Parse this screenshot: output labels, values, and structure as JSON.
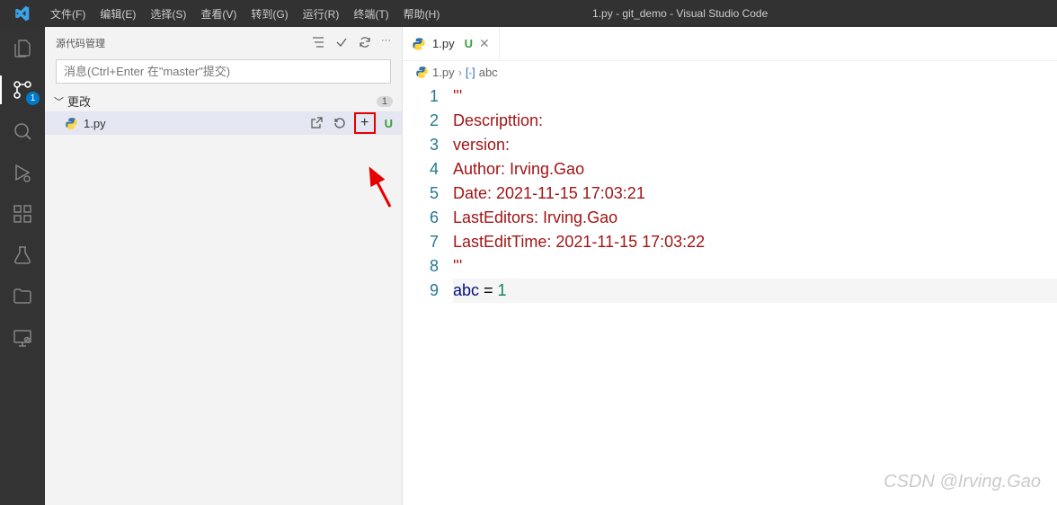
{
  "title": "1.py - git_demo - Visual Studio Code",
  "menu": [
    "文件(F)",
    "编辑(E)",
    "选择(S)",
    "查看(V)",
    "转到(G)",
    "运行(R)",
    "终端(T)",
    "帮助(H)"
  ],
  "activity": {
    "scm_badge": "1"
  },
  "sidebar": {
    "title": "源代码管理",
    "message_placeholder": "消息(Ctrl+Enter 在\"master\"提交)",
    "changes_label": "更改",
    "changes_count": "1",
    "file": {
      "name": "1.py",
      "status": "U"
    }
  },
  "tab": {
    "name": "1.py",
    "status": "U"
  },
  "breadcrumb": {
    "file": "1.py",
    "symbol": "abc"
  },
  "code": {
    "lines": [
      {
        "n": "1",
        "t": "'''",
        "cls": "c-str"
      },
      {
        "n": "2",
        "t": "Descripttion: ",
        "cls": "c-str"
      },
      {
        "n": "3",
        "t": "version: ",
        "cls": "c-str"
      },
      {
        "n": "4",
        "t": "Author: Irving.Gao",
        "cls": "c-str"
      },
      {
        "n": "5",
        "t": "Date: 2021-11-15 17:03:21",
        "cls": "c-str"
      },
      {
        "n": "6",
        "t": "LastEditors: Irving.Gao",
        "cls": "c-str"
      },
      {
        "n": "7",
        "t": "LastEditTime: 2021-11-15 17:03:22",
        "cls": "c-str"
      },
      {
        "n": "8",
        "t": "'''",
        "cls": "c-str"
      },
      {
        "n": "9",
        "t": "abc = 1",
        "cls": "assign"
      }
    ]
  },
  "watermark": "CSDN @Irving.Gao"
}
